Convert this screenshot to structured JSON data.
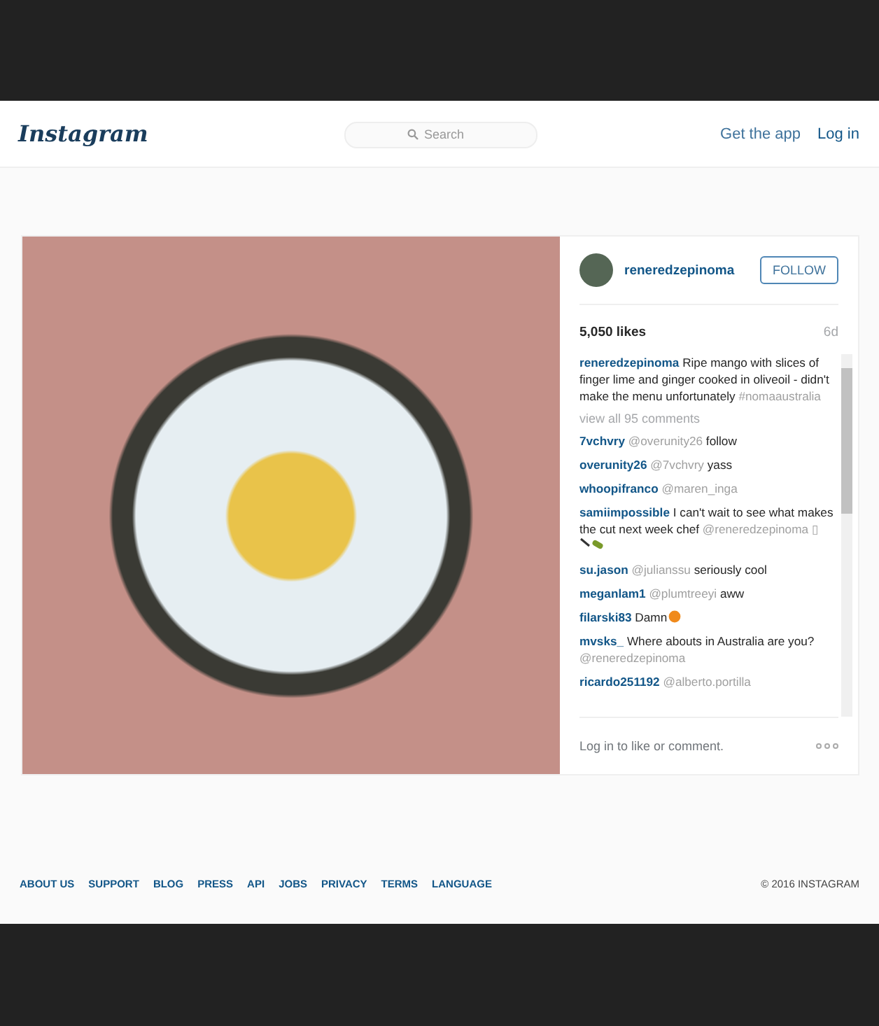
{
  "header": {
    "logo": "Instagram",
    "search": {
      "placeholder": "Search"
    },
    "links": [
      "Get the app",
      "Log in"
    ]
  },
  "post": {
    "username": "reneredzepinoma",
    "follow": "FOLLOW",
    "likes": "5,050 likes",
    "age": "6d",
    "caption": {
      "user": "reneredzepinoma",
      "segments": [
        {
          "kind": "plain",
          "text": "Ripe mango with slices of finger lime and ginger cooked in oliveoil - didn't make the menu unfortunately "
        },
        {
          "kind": "mention",
          "text": "#nomaaustralia"
        }
      ]
    },
    "view_all": "view all 95 comments",
    "comments": [
      {
        "user": "7vchvry",
        "segments": [
          {
            "kind": "mention",
            "text": "@overunity26"
          },
          {
            "kind": "plain",
            "text": " follow"
          }
        ]
      },
      {
        "user": "overunity26",
        "segments": [
          {
            "kind": "mention",
            "text": "@7vchvry"
          },
          {
            "kind": "plain",
            "text": " yass"
          }
        ]
      },
      {
        "user": "whoopifranco",
        "segments": [
          {
            "kind": "mention",
            "text": "@maren_inga"
          }
        ]
      },
      {
        "user": "samiimpossible",
        "segments": [
          {
            "kind": "plain",
            "text": "I can't wait to see what makes the cut next week chef "
          },
          {
            "kind": "mention",
            "text": "@reneredzepinoma ▯"
          },
          {
            "kind": "knife-emoji"
          }
        ]
      },
      {
        "user": "su.jason",
        "segments": [
          {
            "kind": "mention",
            "text": "@julianssu"
          },
          {
            "kind": "plain",
            "text": " seriously cool"
          }
        ]
      },
      {
        "user": "meganlam1",
        "segments": [
          {
            "kind": "mention",
            "text": "@plumtreeyi"
          },
          {
            "kind": "plain",
            "text": " aww"
          }
        ]
      },
      {
        "user": "filarski83",
        "segments": [
          {
            "kind": "plain",
            "text": "Damn"
          },
          {
            "kind": "fruit-emoji"
          }
        ]
      },
      {
        "user": "mvsks_",
        "segments": [
          {
            "kind": "plain",
            "text": "Where abouts in Australia are you? "
          },
          {
            "kind": "mention",
            "text": "@reneredzepinoma"
          }
        ]
      },
      {
        "user": "ricardo251192",
        "segments": [
          {
            "kind": "mention",
            "text": "@alberto.portilla"
          }
        ]
      }
    ],
    "login_prompt": "Log in to like or comment."
  },
  "footer": {
    "links": [
      "ABOUT US",
      "SUPPORT",
      "BLOG",
      "PRESS",
      "API",
      "JOBS",
      "PRIVACY",
      "TERMS",
      "LANGUAGE"
    ],
    "copyright": "© 2016 INSTAGRAM"
  }
}
